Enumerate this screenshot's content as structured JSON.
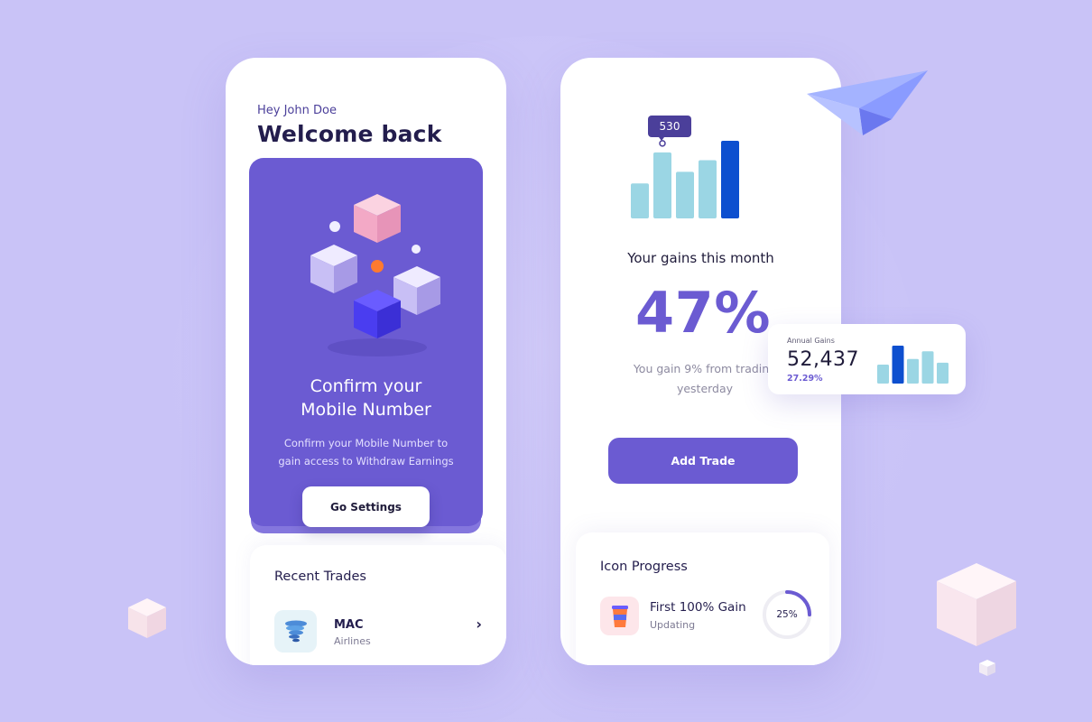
{
  "colors": {
    "background": "#c9c3f7",
    "primary": "#6b5bd2",
    "bar_light": "#9bd6e4",
    "bar_dark": "#0d4fcf",
    "text_dark": "#231d4d"
  },
  "left_phone": {
    "greeting": "Hey John Doe",
    "welcome": "Welcome back",
    "promo": {
      "title": "Confirm your\nMobile Number",
      "description": "Confirm your Mobile Number to\ngain access to Withdraw Earnings",
      "button_label": "Go Settings"
    },
    "recent_trades": {
      "title": "Recent Trades",
      "items": [
        {
          "name": "MAC",
          "subtitle": "Airlines",
          "icon": "tornado-icon"
        }
      ]
    }
  },
  "right_phone": {
    "chart": {
      "tooltip": "530",
      "bars": [
        0.45,
        0.85,
        0.6,
        0.75,
        1.0
      ],
      "highlight_index": 4
    },
    "gains_title": "Your gains this month",
    "gains_percent": "47%",
    "gains_desc": "You gain 9% from trading\nyesterday",
    "add_trade_label": "Add Trade",
    "icon_progress": {
      "title": "Icon Progress",
      "items": [
        {
          "name": "First 100% Gain",
          "status": "Updating",
          "percent_label": "25%",
          "percent": 0.25,
          "icon": "cup-icon"
        }
      ]
    }
  },
  "annual_card": {
    "label": "Annual Gains",
    "value": "52,437",
    "percent": "27.29%",
    "bars": [
      0.5,
      1.0,
      0.65,
      0.85,
      0.55
    ],
    "highlight_index": 1
  }
}
